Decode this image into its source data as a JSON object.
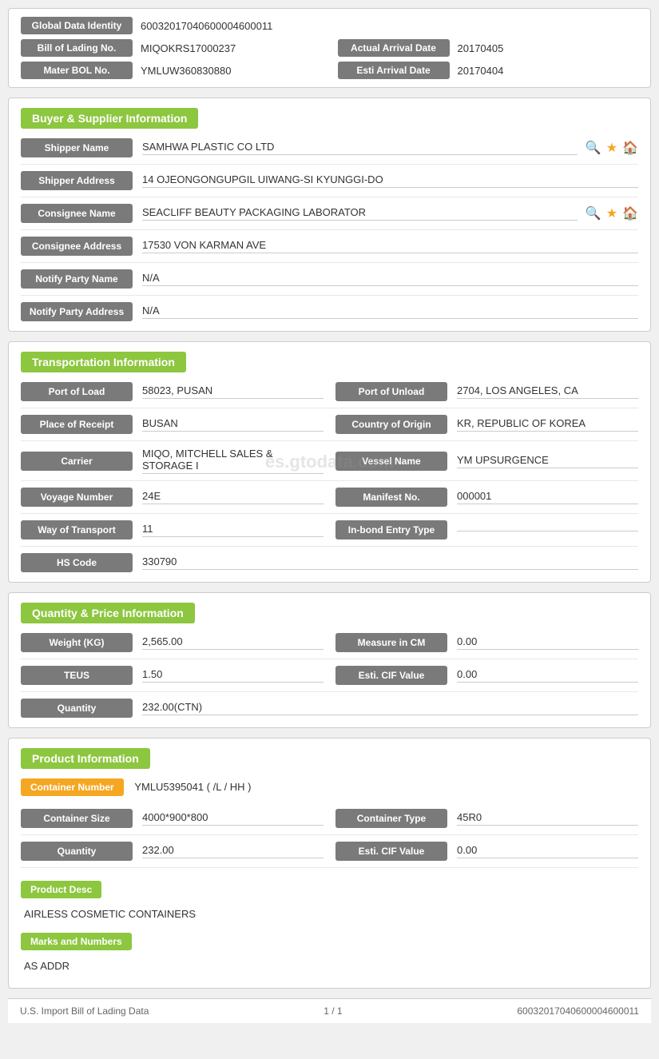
{
  "identity": {
    "global_data_identity_label": "Global Data Identity",
    "global_data_identity_value": "60032017040600004600011",
    "bill_of_lading_label": "Bill of Lading No.",
    "bill_of_lading_value": "MIQOKRS17000237",
    "actual_arrival_date_label": "Actual Arrival Date",
    "actual_arrival_date_value": "20170405",
    "mater_bol_label": "Mater BOL No.",
    "mater_bol_value": "YMLUW360830880",
    "esti_arrival_date_label": "Esti Arrival Date",
    "esti_arrival_date_value": "20170404"
  },
  "buyer_supplier": {
    "section_title": "Buyer & Supplier Information",
    "shipper_name_label": "Shipper Name",
    "shipper_name_value": "SAMHWA PLASTIC CO LTD",
    "shipper_address_label": "Shipper Address",
    "shipper_address_value": "14 OJEONGONGUPGIL UIWANG-SI KYUNGGI-DO",
    "consignee_name_label": "Consignee Name",
    "consignee_name_value": "SEACLIFF BEAUTY PACKAGING LABORATOR",
    "consignee_address_label": "Consignee Address",
    "consignee_address_value": "17530 VON KARMAN AVE",
    "notify_party_name_label": "Notify Party Name",
    "notify_party_name_value": "N/A",
    "notify_party_address_label": "Notify Party Address",
    "notify_party_address_value": "N/A"
  },
  "transportation": {
    "section_title": "Transportation Information",
    "port_of_load_label": "Port of Load",
    "port_of_load_value": "58023, PUSAN",
    "port_of_unload_label": "Port of Unload",
    "port_of_unload_value": "2704, LOS ANGELES, CA",
    "place_of_receipt_label": "Place of Receipt",
    "place_of_receipt_value": "BUSAN",
    "country_of_origin_label": "Country of Origin",
    "country_of_origin_value": "KR, REPUBLIC OF KOREA",
    "carrier_label": "Carrier",
    "carrier_value": "MIQO, MITCHELL SALES & STORAGE I",
    "vessel_name_label": "Vessel Name",
    "vessel_name_value": "YM UPSURGENCE",
    "voyage_number_label": "Voyage Number",
    "voyage_number_value": "24E",
    "manifest_no_label": "Manifest No.",
    "manifest_no_value": "000001",
    "way_of_transport_label": "Way of Transport",
    "way_of_transport_value": "11",
    "in_bond_entry_type_label": "In-bond Entry Type",
    "in_bond_entry_type_value": "",
    "hs_code_label": "HS Code",
    "hs_code_value": "330790"
  },
  "quantity_price": {
    "section_title": "Quantity & Price Information",
    "weight_kg_label": "Weight (KG)",
    "weight_kg_value": "2,565.00",
    "measure_in_cm_label": "Measure in CM",
    "measure_in_cm_value": "0.00",
    "teus_label": "TEUS",
    "teus_value": "1.50",
    "esti_cif_value_label": "Esti. CIF Value",
    "esti_cif_value_value": "0.00",
    "quantity_label": "Quantity",
    "quantity_value": "232.00(CTN)"
  },
  "product_info": {
    "section_title": "Product Information",
    "container_number_label": "Container Number",
    "container_number_value": "YMLU5395041 ( /L / HH )",
    "container_size_label": "Container Size",
    "container_size_value": "4000*900*800",
    "container_type_label": "Container Type",
    "container_type_value": "45R0",
    "quantity_label": "Quantity",
    "quantity_value": "232.00",
    "esti_cif_value_label": "Esti. CIF Value",
    "esti_cif_value_value": "0.00",
    "product_desc_label": "Product Desc",
    "product_desc_value": "AIRLESS COSMETIC CONTAINERS",
    "marks_and_numbers_label": "Marks and Numbers",
    "marks_and_numbers_value": "AS ADDR"
  },
  "footer": {
    "left_text": "U.S. Import Bill of Lading Data",
    "center_text": "1 / 1",
    "right_text": "60032017040600004600011"
  },
  "watermark": "es.gtodata.com"
}
